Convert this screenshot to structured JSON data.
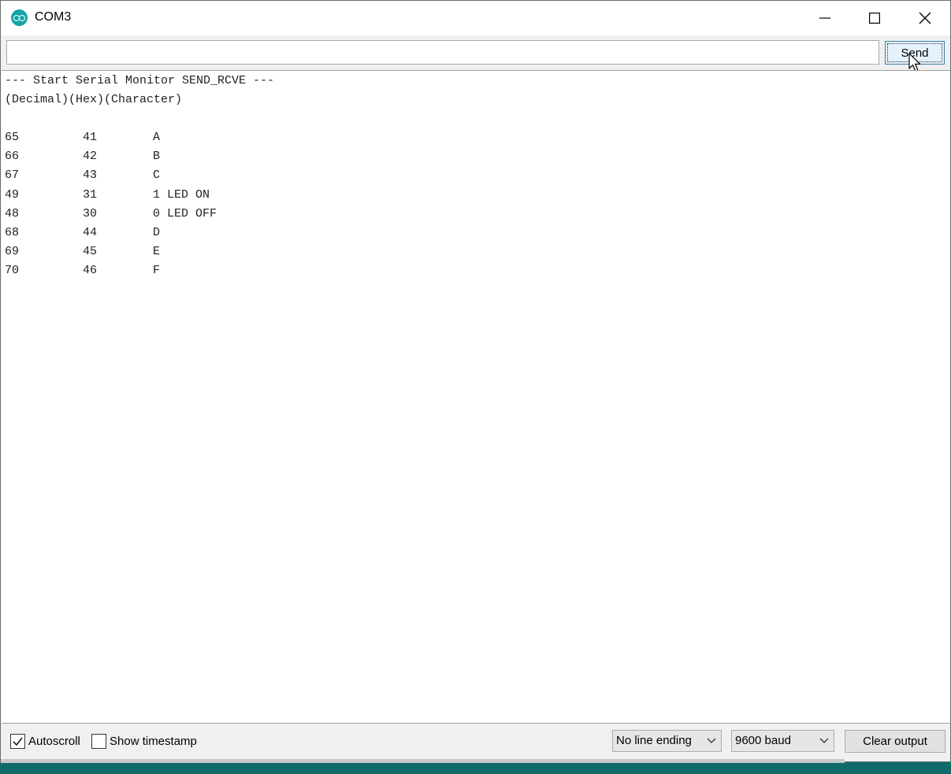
{
  "window": {
    "title": "COM3"
  },
  "send": {
    "input_value": "",
    "button_label": "Send"
  },
  "output": {
    "lines": [
      "--- Start Serial Monitor SEND_RCVE ---",
      "(Decimal)(Hex)(Character)"
    ],
    "rows": [
      {
        "dec": "65",
        "hex": "41",
        "chr": "A"
      },
      {
        "dec": "66",
        "hex": "42",
        "chr": "B"
      },
      {
        "dec": "67",
        "hex": "43",
        "chr": "C"
      },
      {
        "dec": "49",
        "hex": "31",
        "chr": "1 LED ON"
      },
      {
        "dec": "48",
        "hex": "30",
        "chr": "0 LED OFF"
      },
      {
        "dec": "68",
        "hex": "44",
        "chr": "D"
      },
      {
        "dec": "69",
        "hex": "45",
        "chr": "E"
      },
      {
        "dec": "70",
        "hex": "46",
        "chr": "F"
      }
    ]
  },
  "footer": {
    "autoscroll": {
      "label": "Autoscroll",
      "checked": true
    },
    "timestamp": {
      "label": "Show timestamp",
      "checked": false
    },
    "line_ending": {
      "value": "No line ending"
    },
    "baud": {
      "value": "9600 baud"
    },
    "clear_label": "Clear output"
  },
  "colors": {
    "app_icon": "#15a3a7",
    "send_button_bg": "#e5f1fb",
    "send_button_border": "#3c7fb1",
    "desktop": "#0f6b6a"
  }
}
